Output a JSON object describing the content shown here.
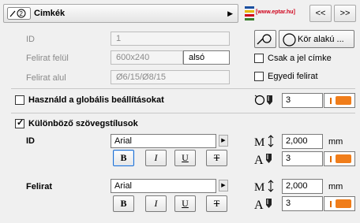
{
  "header": {
    "title": "Cimkék",
    "logo_text": "[www.eptar.hu]",
    "prev_label": "<<",
    "next_label": ">>"
  },
  "fields": {
    "id_label": "ID",
    "id_value": "1",
    "top_label": "Felirat felül",
    "top_value": "600x240",
    "top_pos": "alsó",
    "bottom_label": "Felirat alul",
    "bottom_value": "Ø6/15/Ø8/15",
    "shape_label": "Kör alakú ...",
    "only_mark_label": "Csak a jel címke",
    "custom_label": "Egyedi felirat"
  },
  "global": {
    "label": "Használd a globális beállításokat",
    "pen": "3"
  },
  "styles": {
    "label": "Különböző szövegstílusok",
    "unit": "mm",
    "id": {
      "title": "ID",
      "font": "Arial",
      "size": "2,000",
      "pen": "3",
      "b": "B",
      "i": "I",
      "u": "U",
      "s": "T"
    },
    "text": {
      "title": "Felirat",
      "font": "Arial",
      "size": "2,000",
      "pen": "3",
      "b": "B",
      "i": "I",
      "u": "U",
      "s": "T"
    }
  },
  "colors": {
    "pen_orange": "#f07d1a",
    "accent_blue": "#1e6fd0",
    "logo_red": "#d0021b"
  }
}
